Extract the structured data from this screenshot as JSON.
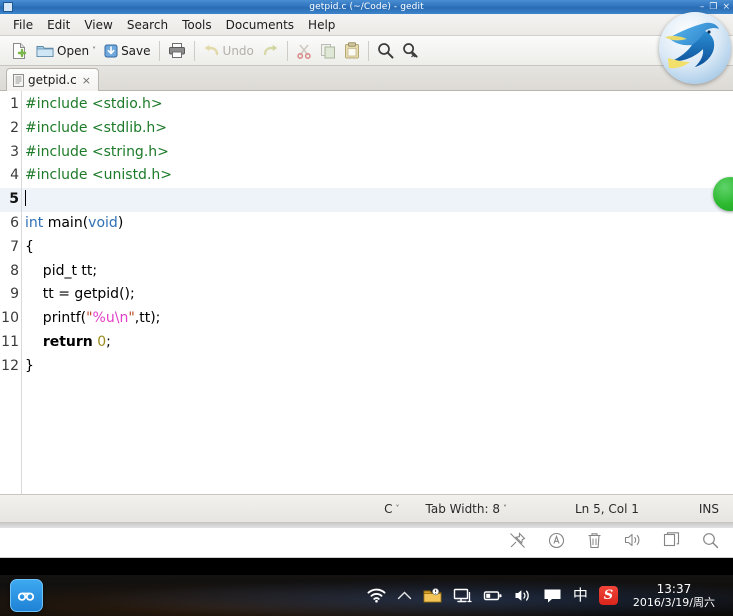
{
  "window": {
    "title": "getpid.c (~/Code) - gedit",
    "icon": "gedit-window-icon",
    "buttons": {
      "minimize": "–",
      "maximize": "❐",
      "close": "×"
    }
  },
  "menubar": {
    "items": [
      {
        "label": "File",
        "name": "menu-file"
      },
      {
        "label": "Edit",
        "name": "menu-edit"
      },
      {
        "label": "View",
        "name": "menu-view"
      },
      {
        "label": "Search",
        "name": "menu-search"
      },
      {
        "label": "Tools",
        "name": "menu-tools"
      },
      {
        "label": "Documents",
        "name": "menu-documents"
      },
      {
        "label": "Help",
        "name": "menu-help"
      }
    ]
  },
  "toolbar": {
    "new_label": "",
    "open_label": "Open",
    "open_chevron": "˅",
    "save_label": "Save",
    "print_label": "",
    "undo_label": "Undo",
    "redo_label": "",
    "cut_label": "",
    "copy_label": "",
    "paste_label": "",
    "find_label": "",
    "replace_label": ""
  },
  "tabs": [
    {
      "title": "getpid.c",
      "close": "×",
      "active": true
    }
  ],
  "editor": {
    "lines": [
      {
        "num": "1",
        "current": false
      },
      {
        "num": "2",
        "current": false
      },
      {
        "num": "3",
        "current": false
      },
      {
        "num": "4",
        "current": false
      },
      {
        "num": "5",
        "current": true
      },
      {
        "num": "6",
        "current": false
      },
      {
        "num": "7",
        "current": false
      },
      {
        "num": "8",
        "current": false
      },
      {
        "num": "9",
        "current": false
      },
      {
        "num": "10",
        "current": false
      },
      {
        "num": "11",
        "current": false
      },
      {
        "num": "12",
        "current": false
      }
    ],
    "code": {
      "l1": "#include <stdio.h>",
      "l2": "#include <stdlib.h>",
      "l3": "#include <string.h>",
      "l4": "#include <unistd.h>",
      "l5": "",
      "l6_int": "int",
      "l6_main": " main(",
      "l6_void": "void",
      "l6_close": ")",
      "l7": "{",
      "l8": "    pid_t tt;",
      "l9": "    tt = getpid();",
      "l10_a": "    printf(",
      "l10_q1": "\"",
      "l10_fmt": "%u\\n",
      "l10_q2": "\"",
      "l10_b": ",tt);",
      "l11_ret": "return",
      "l11_num": "0",
      "l11_semi": ";",
      "l12": "}"
    },
    "indicator": "green-status-indicator"
  },
  "statusbar": {
    "language": "C",
    "language_chevron": "˅",
    "tab_width": "Tab Width: 8",
    "tab_width_chevron": "˅",
    "cursor_position": "Ln 5, Col 1",
    "insert_mode": "INS"
  },
  "bottom_panel": {
    "icons": [
      {
        "name": "pin-off-icon"
      },
      {
        "name": "accessibility-icon"
      },
      {
        "name": "trash-icon"
      },
      {
        "name": "volume-icon"
      },
      {
        "name": "window-icon"
      },
      {
        "name": "search-icon"
      }
    ]
  },
  "taskbar": {
    "app_icon": "baidu-cloud-icon",
    "tray": [
      {
        "name": "wifi-icon"
      },
      {
        "name": "chevron-up-icon"
      },
      {
        "name": "folder-warning-icon"
      },
      {
        "name": "display-icon"
      },
      {
        "name": "battery-icon"
      },
      {
        "name": "speaker-icon"
      },
      {
        "name": "message-icon"
      }
    ],
    "ime_label": "中",
    "sogou_label": "S",
    "clock_time": "13:37",
    "clock_date": "2016/3/19/周六"
  },
  "logo": {
    "name": "blue-bird-logo"
  },
  "colors": {
    "titlebar_blue": "#2f74bd",
    "preprocessor_green": "#1c7a28",
    "keyword_blue": "#2f6fb5",
    "string_red": "#b5492b",
    "escape_magenta": "#e23ec8",
    "number_olive": "#9a8b1c",
    "current_line": "#eef3fa",
    "indicator_green": "#2cb82f",
    "sogou_red": "#d8251b"
  }
}
